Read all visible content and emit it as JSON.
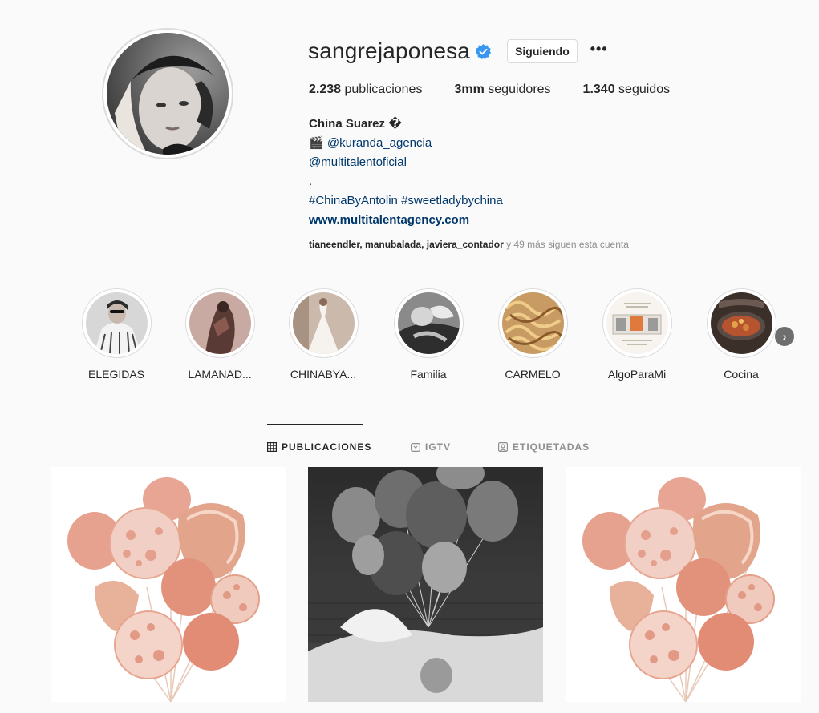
{
  "profile": {
    "username": "sangrejaponesa",
    "verified_icon": "verified-badge-icon",
    "follow_state": "Siguiendo",
    "more_icon": "•••",
    "stats": {
      "posts_count": "2.238",
      "posts_label": "publicaciones",
      "followers_count": "3mm",
      "followers_label": "seguidores",
      "following_count": "1.340",
      "following_label": "seguidos"
    },
    "bio": {
      "name": "China Suarez �",
      "line1_emoji": "🎬",
      "line1_link": "@kuranda_agencia",
      "line2_link": "@multitalentoficial",
      "line3": ".",
      "line4": "#ChinaByAntolin #sweetladybychina",
      "website": "www.multitalentagency.com"
    },
    "followed_by": {
      "user1": "tianeendler",
      "user2": "manubalada",
      "user3": "javiera_contador",
      "rest": "y 49 más siguen esta cuenta"
    }
  },
  "highlights": [
    {
      "label": "ELEGIDAS"
    },
    {
      "label": "LAMANAD..."
    },
    {
      "label": "CHINABYA..."
    },
    {
      "label": "Familia"
    },
    {
      "label": "CARMELO"
    },
    {
      "label": "AlgoParaMi"
    },
    {
      "label": "Cocina"
    }
  ],
  "highlights_next_icon": "›",
  "tabs": {
    "posts": "PUBLICACIONES",
    "igtv": "IGTV",
    "tagged": "ETIQUETADAS"
  },
  "colors": {
    "link": "#00376b",
    "verified": "#3897f0",
    "muted": "#8e8e8e",
    "text": "#262626",
    "border": "#dbdbdb"
  }
}
